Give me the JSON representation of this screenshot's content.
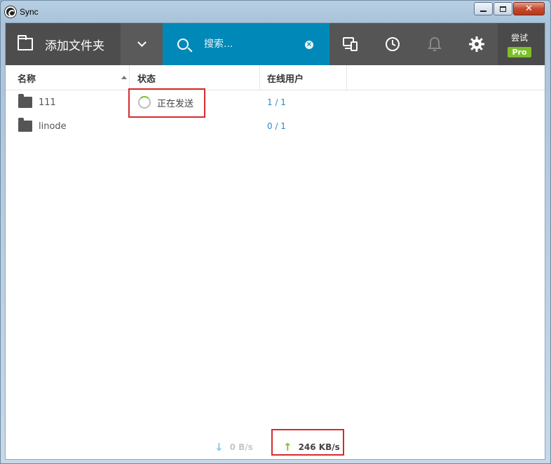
{
  "window": {
    "title": "Sync"
  },
  "toolbar": {
    "add_folder_label": "添加文件夹",
    "search_placeholder": "搜索...",
    "trial_label": "尝试",
    "pro_badge": "Pro"
  },
  "table": {
    "columns": [
      "名称",
      "状态",
      "在线用户"
    ],
    "rows": [
      {
        "name": "111",
        "status": "正在发送",
        "users": "1 / 1"
      },
      {
        "name": "linode",
        "status": "",
        "users": "0 / 1"
      }
    ]
  },
  "statusbar": {
    "download_rate": "0 B/s",
    "upload_rate": "246 KB/s"
  },
  "colors": {
    "accent_blue": "#0089b8",
    "pro_green": "#7bbf2a",
    "highlight_red": "#d62b2b",
    "link_blue": "#2b8ac6"
  }
}
